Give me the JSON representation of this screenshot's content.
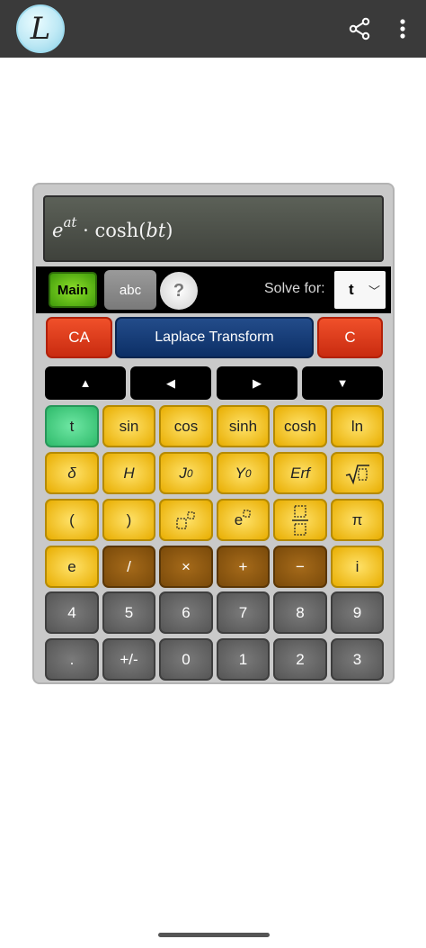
{
  "app": {
    "logo_letter": "L"
  },
  "display": {
    "expression": {
      "base": "e",
      "exponent": "at",
      "op": "·",
      "fn": "cosh",
      "arg": "bt"
    }
  },
  "toolbar": {
    "main_label": "Main",
    "abc_label": "abc",
    "help_label": "?",
    "solve_for_label": "Solve for:",
    "solve_for_value": "t"
  },
  "controls": {
    "ca": "CA",
    "transform": "Laplace Transform",
    "c": "C"
  },
  "arrows": {
    "up": "▲",
    "left": "◀",
    "right": "▶",
    "down": "▼"
  },
  "keys": {
    "row1": [
      "t",
      "sin",
      "cos",
      "sinh",
      "cosh",
      "ln"
    ],
    "row2": [
      "δ",
      "H",
      "J",
      "0",
      "Y",
      "0",
      "Erf"
    ],
    "row3": [
      "(",
      ")",
      "e",
      "π"
    ],
    "row4": [
      "e",
      "/",
      "×",
      "+",
      "−",
      "i"
    ],
    "row5": [
      "4",
      "5",
      "6",
      "7",
      "8",
      "9"
    ],
    "row6": [
      ".",
      "+/-",
      "0",
      "1",
      "2",
      "3"
    ]
  },
  "colors": {
    "accent_green": "#5fc41a",
    "yellow": "#f2c31a",
    "brown": "#8b5a12",
    "red": "#e03c1c",
    "blue": "#123a75"
  }
}
